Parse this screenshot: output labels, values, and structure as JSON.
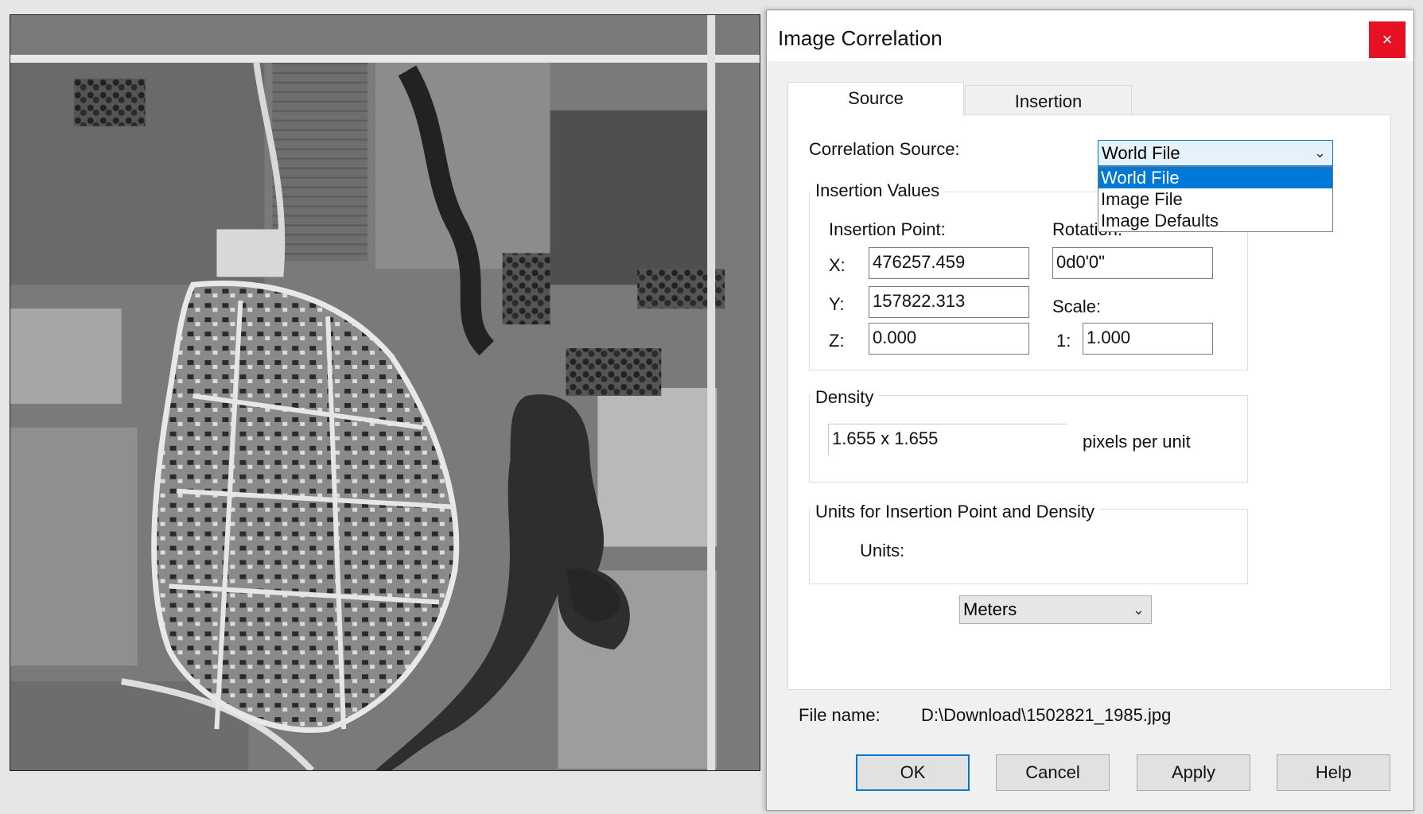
{
  "dialog": {
    "title": "Image Correlation",
    "close_label": "×",
    "tabs": [
      {
        "label": "Source",
        "active": true
      },
      {
        "label": "Insertion",
        "active": false
      }
    ],
    "correlation_source": {
      "label": "Correlation Source:",
      "value": "World File",
      "options": [
        "World File",
        "Image File",
        "Image Defaults"
      ],
      "selected_option": "World File"
    },
    "insertion_values": {
      "group_title": "Insertion Values",
      "insertion_point_label": "Insertion Point:",
      "x_label": "X:",
      "x_value": "476257.459",
      "y_label": "Y:",
      "y_value": "157822.313",
      "z_label": "Z:",
      "z_value": "0.000",
      "rotation_label": "Rotation:",
      "rotation_value": "0d0'0\"",
      "scale_label": "Scale:",
      "scale_prefix": "1:",
      "scale_value": "1.000"
    },
    "density": {
      "group_title": "Density",
      "value": "1.655 x 1.655",
      "unit_label": "pixels per unit"
    },
    "units": {
      "group_title": "Units for Insertion Point and Density",
      "label": "Units:",
      "value": "Meters"
    },
    "file": {
      "label": "File name:",
      "value": "D:\\Download\\1502821_1985.jpg"
    },
    "buttons": {
      "ok": "OK",
      "cancel": "Cancel",
      "apply": "Apply",
      "help": "Help"
    },
    "accent_color": "#0078d7",
    "close_color": "#e81123"
  },
  "photo": {
    "description_icon": "aerial-photo-grayscale"
  }
}
